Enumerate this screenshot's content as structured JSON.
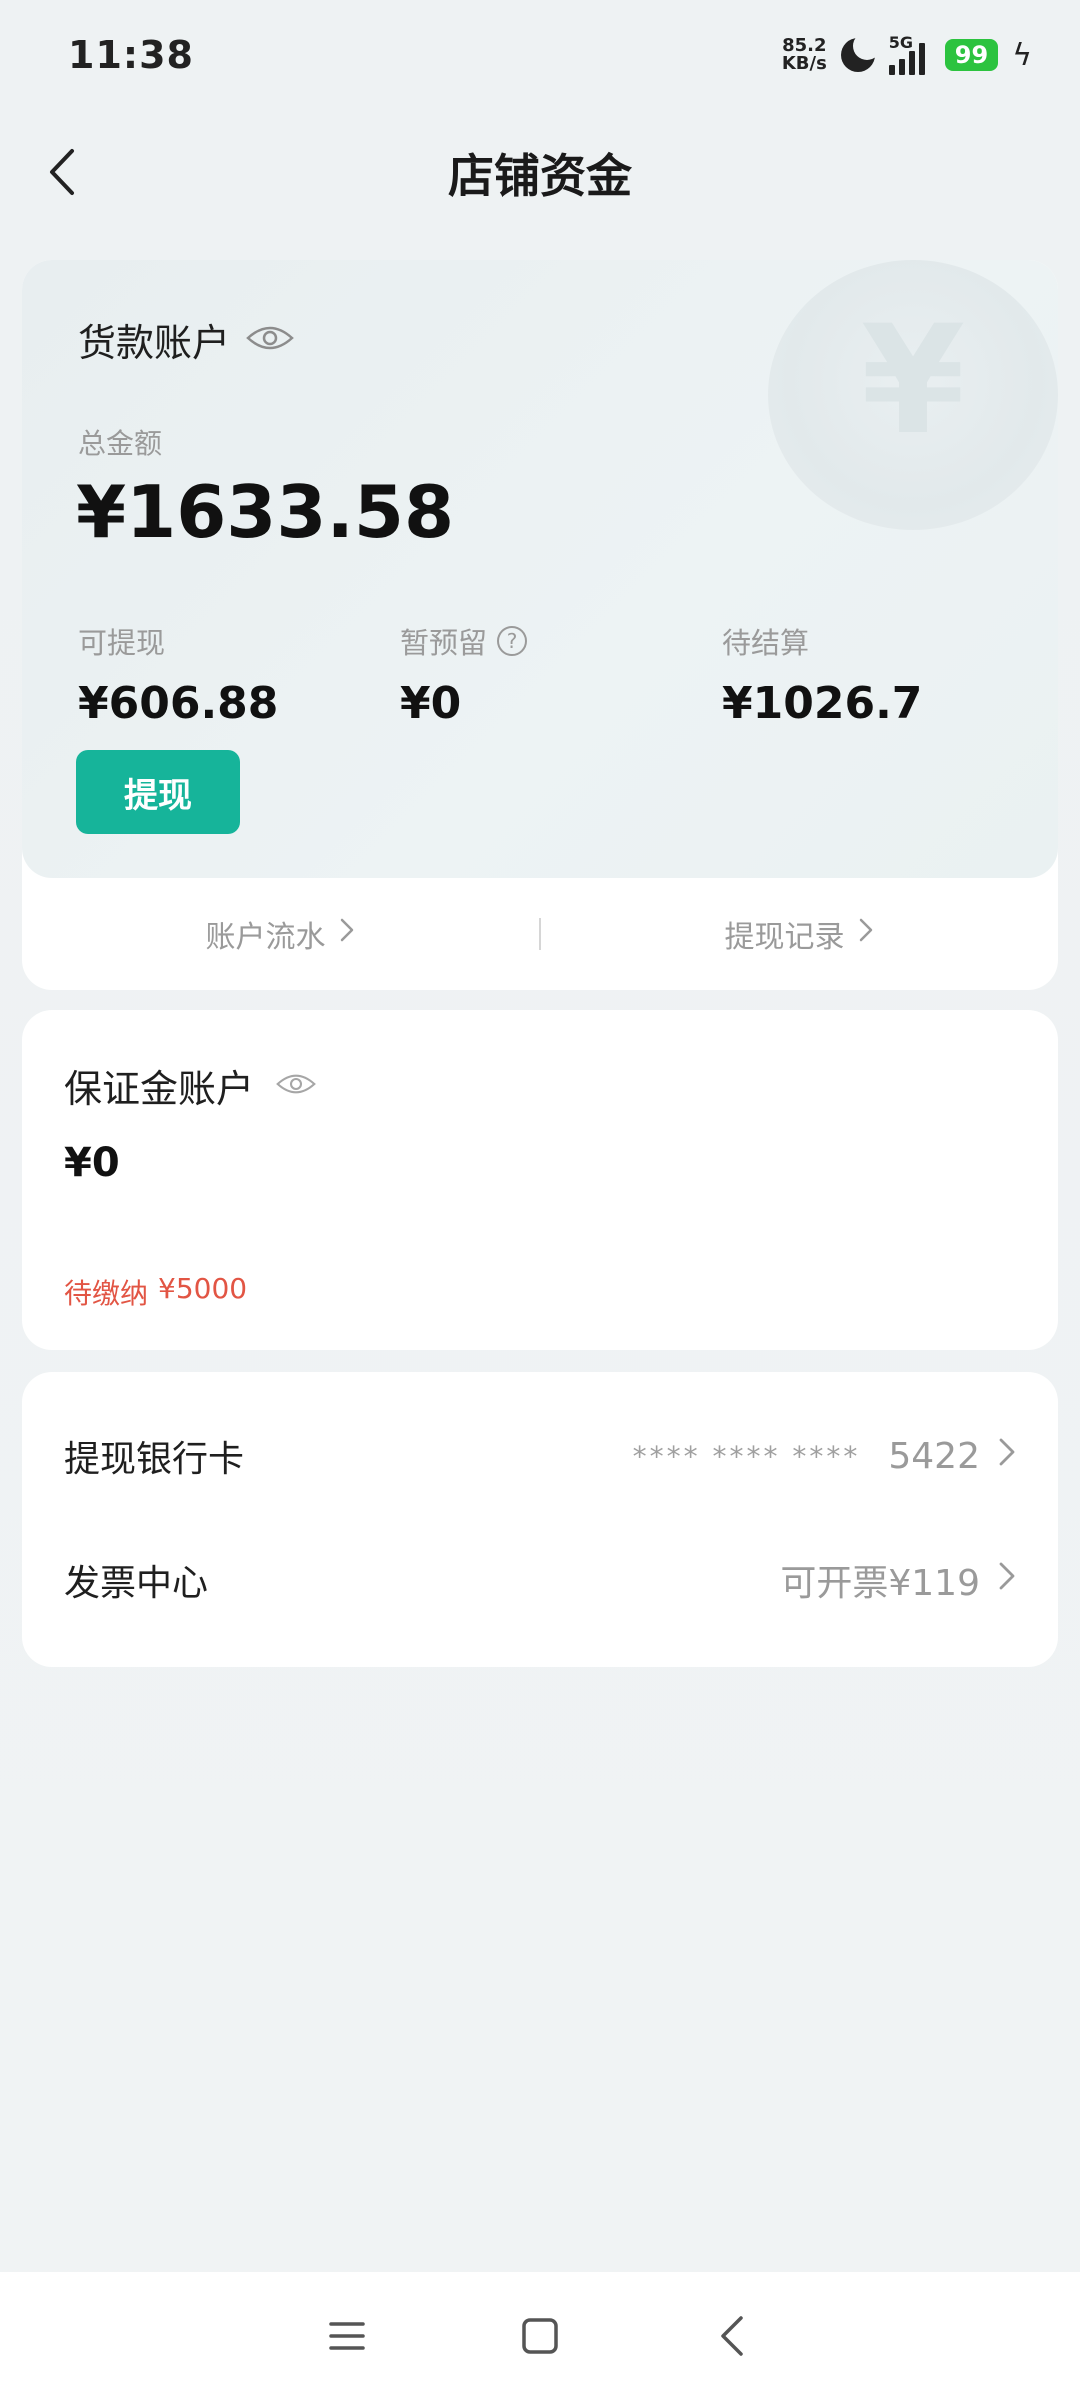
{
  "status": {
    "time": "11:38",
    "net_speed_value": "85.2",
    "net_speed_unit": "KB/s",
    "network": "5G",
    "battery": "99"
  },
  "header": {
    "title": "店铺资金"
  },
  "goods_account": {
    "title": "货款账户",
    "total_label": "总金额",
    "total_amount": "¥1633.58",
    "withdrawable_label": "可提现",
    "withdrawable_value": "¥606.88",
    "reserved_label": "暂预留",
    "reserved_value": "¥0",
    "pending_label": "待结算",
    "pending_value": "¥1026.7",
    "withdraw_button": "提现",
    "link_flow": "账户流水",
    "link_records": "提现记录"
  },
  "deposit_account": {
    "title": "保证金账户",
    "amount": "¥0",
    "pending_label": "待缴纳",
    "pending_amount": "¥5000"
  },
  "menu": {
    "bank_card_label": "提现银行卡",
    "bank_card_mask": "**** **** ****",
    "bank_card_last4": "5422",
    "invoice_label": "发票中心",
    "invoice_value": "可开票¥119"
  },
  "colors": {
    "accent": "#16b49a",
    "warning": "#e25544",
    "battery": "#2cc33f"
  },
  "icons": {
    "back": "chevron-left-icon",
    "eye": "eye-icon",
    "help": "question-circle-icon",
    "chevron": "chevron-right-icon",
    "nav_menu": "menu-icon",
    "nav_home": "square-home-icon",
    "nav_back": "back-triangle-icon"
  }
}
